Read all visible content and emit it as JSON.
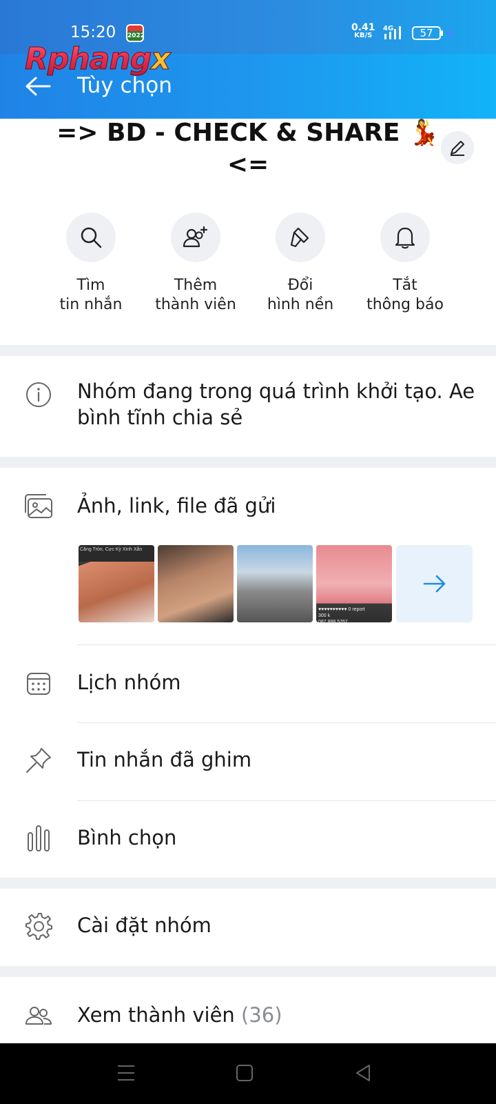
{
  "status_bar": {
    "time": "15:20",
    "calendar_badge": "2022",
    "net_speed_value": "0.41",
    "net_speed_unit": "KB/S",
    "network_type": "4G",
    "battery": "57"
  },
  "watermark": {
    "text_main": "Rphang",
    "text_x": "x"
  },
  "header": {
    "title": "Tùy chọn"
  },
  "group": {
    "name_line1": "=> BD - CHECK & SHARE 💃",
    "name_line2": "<="
  },
  "actions": [
    {
      "label": "Tìm\ntin nhắn",
      "icon": "search-icon"
    },
    {
      "label": "Thêm\nthành viên",
      "icon": "add-member-icon"
    },
    {
      "label": "Đổi\nhình nền",
      "icon": "paint-brush-icon"
    },
    {
      "label": "Tắt\nthông báo",
      "icon": "bell-icon"
    }
  ],
  "info": {
    "text": "Nhóm đang trong quá trình khởi tạo. Ae bình tĩnh chia sẻ"
  },
  "media": {
    "label": "Ảnh, link, file đã gửi",
    "thumb1_caption": "Căng Tròn, Cực Kỳ Xinh Xắn",
    "thumb4_caption": "♥♥♥♥♥♥♥♥♥♥ 0 report\n300 k\n087.888.5767"
  },
  "menu": {
    "calendar": "Lịch nhóm",
    "pinned": "Tin nhắn đã ghim",
    "poll": "Bình chọn",
    "settings": "Cài đặt nhóm",
    "members": "Xem thành viên",
    "members_count": "(36)"
  },
  "colors": {
    "header_start": "#1f83e6",
    "header_end": "#12b3f8",
    "accent": "#1d8fe1",
    "separator": "#eef0f3"
  }
}
